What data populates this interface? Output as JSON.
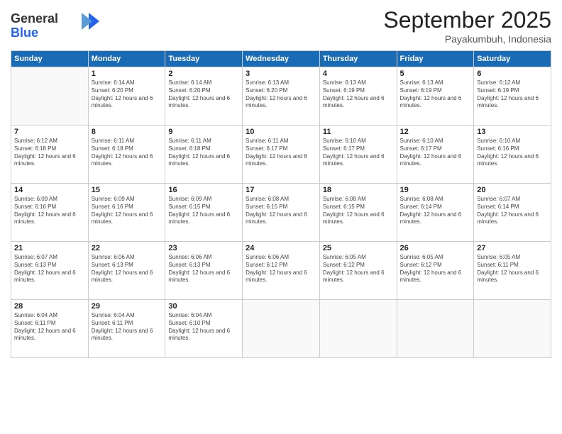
{
  "logo": {
    "general": "General",
    "blue": "Blue"
  },
  "header": {
    "month": "September 2025",
    "location": "Payakumbuh, Indonesia"
  },
  "days_header": [
    "Sunday",
    "Monday",
    "Tuesday",
    "Wednesday",
    "Thursday",
    "Friday",
    "Saturday"
  ],
  "weeks": [
    [
      {
        "day": "",
        "sunrise": "",
        "sunset": "",
        "daylight": ""
      },
      {
        "day": "1",
        "sunrise": "Sunrise: 6:14 AM",
        "sunset": "Sunset: 6:20 PM",
        "daylight": "Daylight: 12 hours and 6 minutes."
      },
      {
        "day": "2",
        "sunrise": "Sunrise: 6:14 AM",
        "sunset": "Sunset: 6:20 PM",
        "daylight": "Daylight: 12 hours and 6 minutes."
      },
      {
        "day": "3",
        "sunrise": "Sunrise: 6:13 AM",
        "sunset": "Sunset: 6:20 PM",
        "daylight": "Daylight: 12 hours and 6 minutes."
      },
      {
        "day": "4",
        "sunrise": "Sunrise: 6:13 AM",
        "sunset": "Sunset: 6:19 PM",
        "daylight": "Daylight: 12 hours and 6 minutes."
      },
      {
        "day": "5",
        "sunrise": "Sunrise: 6:13 AM",
        "sunset": "Sunset: 6:19 PM",
        "daylight": "Daylight: 12 hours and 6 minutes."
      },
      {
        "day": "6",
        "sunrise": "Sunrise: 6:12 AM",
        "sunset": "Sunset: 6:19 PM",
        "daylight": "Daylight: 12 hours and 6 minutes."
      }
    ],
    [
      {
        "day": "7",
        "sunrise": "Sunrise: 6:12 AM",
        "sunset": "Sunset: 6:18 PM",
        "daylight": "Daylight: 12 hours and 6 minutes."
      },
      {
        "day": "8",
        "sunrise": "Sunrise: 6:11 AM",
        "sunset": "Sunset: 6:18 PM",
        "daylight": "Daylight: 12 hours and 6 minutes."
      },
      {
        "day": "9",
        "sunrise": "Sunrise: 6:11 AM",
        "sunset": "Sunset: 6:18 PM",
        "daylight": "Daylight: 12 hours and 6 minutes."
      },
      {
        "day": "10",
        "sunrise": "Sunrise: 6:11 AM",
        "sunset": "Sunset: 6:17 PM",
        "daylight": "Daylight: 12 hours and 6 minutes."
      },
      {
        "day": "11",
        "sunrise": "Sunrise: 6:10 AM",
        "sunset": "Sunset: 6:17 PM",
        "daylight": "Daylight: 12 hours and 6 minutes."
      },
      {
        "day": "12",
        "sunrise": "Sunrise: 6:10 AM",
        "sunset": "Sunset: 6:17 PM",
        "daylight": "Daylight: 12 hours and 6 minutes."
      },
      {
        "day": "13",
        "sunrise": "Sunrise: 6:10 AM",
        "sunset": "Sunset: 6:16 PM",
        "daylight": "Daylight: 12 hours and 6 minutes."
      }
    ],
    [
      {
        "day": "14",
        "sunrise": "Sunrise: 6:09 AM",
        "sunset": "Sunset: 6:16 PM",
        "daylight": "Daylight: 12 hours and 6 minutes."
      },
      {
        "day": "15",
        "sunrise": "Sunrise: 6:09 AM",
        "sunset": "Sunset: 6:16 PM",
        "daylight": "Daylight: 12 hours and 6 minutes."
      },
      {
        "day": "16",
        "sunrise": "Sunrise: 6:09 AM",
        "sunset": "Sunset: 6:15 PM",
        "daylight": "Daylight: 12 hours and 6 minutes."
      },
      {
        "day": "17",
        "sunrise": "Sunrise: 6:08 AM",
        "sunset": "Sunset: 6:15 PM",
        "daylight": "Daylight: 12 hours and 6 minutes."
      },
      {
        "day": "18",
        "sunrise": "Sunrise: 6:08 AM",
        "sunset": "Sunset: 6:15 PM",
        "daylight": "Daylight: 12 hours and 6 minutes."
      },
      {
        "day": "19",
        "sunrise": "Sunrise: 6:08 AM",
        "sunset": "Sunset: 6:14 PM",
        "daylight": "Daylight: 12 hours and 6 minutes."
      },
      {
        "day": "20",
        "sunrise": "Sunrise: 6:07 AM",
        "sunset": "Sunset: 6:14 PM",
        "daylight": "Daylight: 12 hours and 6 minutes."
      }
    ],
    [
      {
        "day": "21",
        "sunrise": "Sunrise: 6:07 AM",
        "sunset": "Sunset: 6:13 PM",
        "daylight": "Daylight: 12 hours and 6 minutes."
      },
      {
        "day": "22",
        "sunrise": "Sunrise: 6:06 AM",
        "sunset": "Sunset: 6:13 PM",
        "daylight": "Daylight: 12 hours and 6 minutes."
      },
      {
        "day": "23",
        "sunrise": "Sunrise: 6:06 AM",
        "sunset": "Sunset: 6:13 PM",
        "daylight": "Daylight: 12 hours and 6 minutes."
      },
      {
        "day": "24",
        "sunrise": "Sunrise: 6:06 AM",
        "sunset": "Sunset: 6:12 PM",
        "daylight": "Daylight: 12 hours and 6 minutes."
      },
      {
        "day": "25",
        "sunrise": "Sunrise: 6:05 AM",
        "sunset": "Sunset: 6:12 PM",
        "daylight": "Daylight: 12 hours and 6 minutes."
      },
      {
        "day": "26",
        "sunrise": "Sunrise: 6:05 AM",
        "sunset": "Sunset: 6:12 PM",
        "daylight": "Daylight: 12 hours and 6 minutes."
      },
      {
        "day": "27",
        "sunrise": "Sunrise: 6:05 AM",
        "sunset": "Sunset: 6:11 PM",
        "daylight": "Daylight: 12 hours and 6 minutes."
      }
    ],
    [
      {
        "day": "28",
        "sunrise": "Sunrise: 6:04 AM",
        "sunset": "Sunset: 6:11 PM",
        "daylight": "Daylight: 12 hours and 6 minutes."
      },
      {
        "day": "29",
        "sunrise": "Sunrise: 6:04 AM",
        "sunset": "Sunset: 6:11 PM",
        "daylight": "Daylight: 12 hours and 6 minutes."
      },
      {
        "day": "30",
        "sunrise": "Sunrise: 6:04 AM",
        "sunset": "Sunset: 6:10 PM",
        "daylight": "Daylight: 12 hours and 6 minutes."
      },
      {
        "day": "",
        "sunrise": "",
        "sunset": "",
        "daylight": ""
      },
      {
        "day": "",
        "sunrise": "",
        "sunset": "",
        "daylight": ""
      },
      {
        "day": "",
        "sunrise": "",
        "sunset": "",
        "daylight": ""
      },
      {
        "day": "",
        "sunrise": "",
        "sunset": "",
        "daylight": ""
      }
    ]
  ]
}
